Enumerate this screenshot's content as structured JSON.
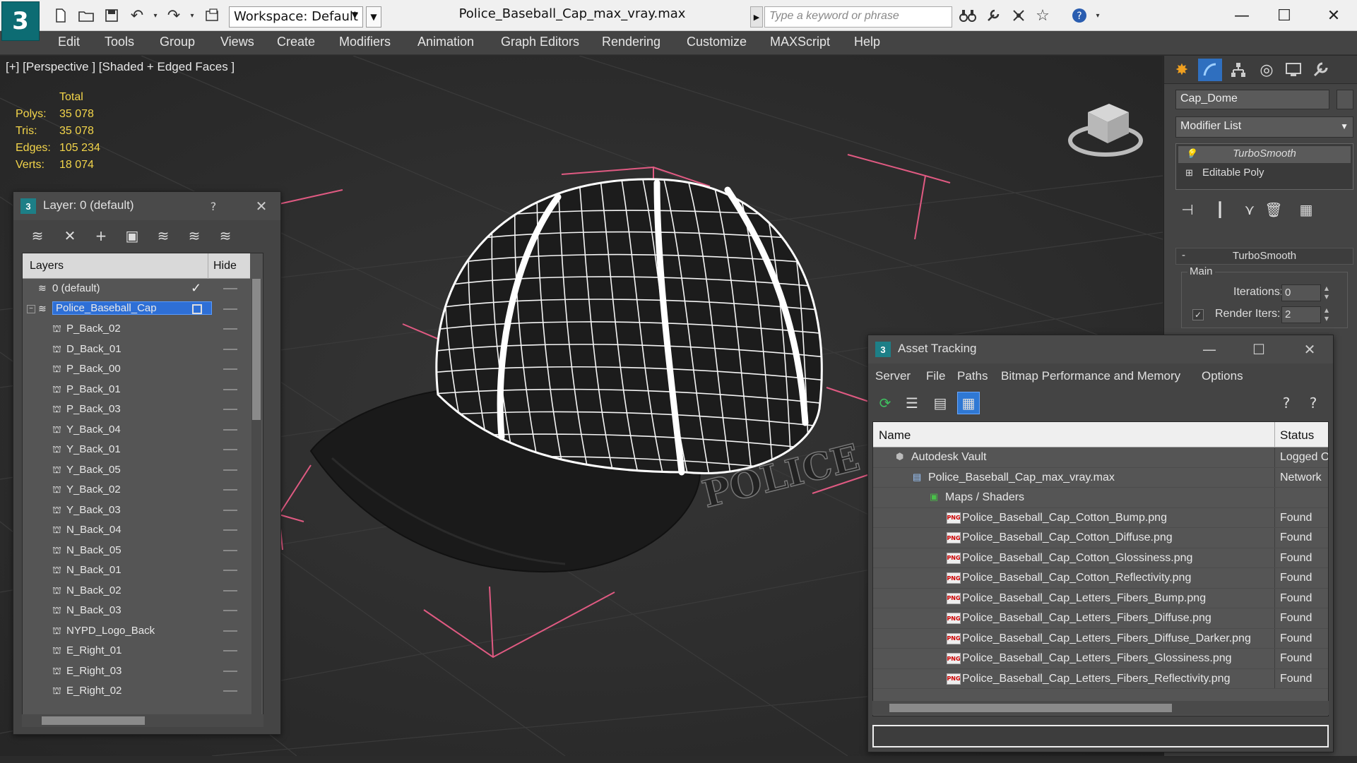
{
  "app": {
    "workspace_label": "Workspace: Default",
    "document_title": "Police_Baseball_Cap_max_vray.max",
    "search_placeholder": "Type a keyword or phrase"
  },
  "menu": [
    "Edit",
    "Tools",
    "Group",
    "Views",
    "Create",
    "Modifiers",
    "Animation",
    "Graph Editors",
    "Rendering",
    "Customize",
    "MAXScript",
    "Help"
  ],
  "viewport": {
    "label": "[+] [Perspective ] [Shaded + Edged Faces ]",
    "stats": {
      "header": "Total",
      "rows": [
        {
          "k": "Polys:",
          "v": "35 078"
        },
        {
          "k": "Tris:",
          "v": "35 078"
        },
        {
          "k": "Edges:",
          "v": "105 234"
        },
        {
          "k": "Verts:",
          "v": "18 074"
        }
      ]
    },
    "cap_text": "POLICE"
  },
  "command_panel": {
    "object_name": "Cap_Dome",
    "modifier_list": "Modifier List",
    "stack": [
      "TurboSmooth",
      "Editable Poly"
    ],
    "rollout_title": "TurboSmooth",
    "group_label": "Main",
    "iterations_label": "Iterations:",
    "iterations_value": "0",
    "render_iters_label": "Render Iters:",
    "render_iters_value": "2"
  },
  "layer_window": {
    "title": "Layer: 0 (default)",
    "help": "?",
    "col_layers": "Layers",
    "col_hide": "Hide",
    "layers": [
      {
        "name": "0 (default)",
        "level": 0,
        "type": "layer",
        "current": true
      },
      {
        "name": "Police_Baseball_Cap",
        "level": 0,
        "type": "layer",
        "selected": true
      },
      {
        "name": "P_Back_02",
        "level": 1,
        "type": "object"
      },
      {
        "name": "D_Back_01",
        "level": 1,
        "type": "object"
      },
      {
        "name": "P_Back_00",
        "level": 1,
        "type": "object"
      },
      {
        "name": "P_Back_01",
        "level": 1,
        "type": "object"
      },
      {
        "name": "P_Back_03",
        "level": 1,
        "type": "object"
      },
      {
        "name": "Y_Back_04",
        "level": 1,
        "type": "object"
      },
      {
        "name": "Y_Back_01",
        "level": 1,
        "type": "object"
      },
      {
        "name": "Y_Back_05",
        "level": 1,
        "type": "object"
      },
      {
        "name": "Y_Back_02",
        "level": 1,
        "type": "object"
      },
      {
        "name": "Y_Back_03",
        "level": 1,
        "type": "object"
      },
      {
        "name": "N_Back_04",
        "level": 1,
        "type": "object"
      },
      {
        "name": "N_Back_05",
        "level": 1,
        "type": "object"
      },
      {
        "name": "N_Back_01",
        "level": 1,
        "type": "object"
      },
      {
        "name": "N_Back_02",
        "level": 1,
        "type": "object"
      },
      {
        "name": "N_Back_03",
        "level": 1,
        "type": "object"
      },
      {
        "name": "NYPD_Logo_Back",
        "level": 1,
        "type": "object"
      },
      {
        "name": "E_Right_01",
        "level": 1,
        "type": "object"
      },
      {
        "name": "E_Right_03",
        "level": 1,
        "type": "object"
      },
      {
        "name": "E_Right_02",
        "level": 1,
        "type": "object"
      }
    ]
  },
  "asset_window": {
    "title": "Asset Tracking",
    "menu": [
      "Server",
      "File",
      "Paths",
      "Bitmap Performance and Memory",
      "Options"
    ],
    "col_name": "Name",
    "col_status": "Status",
    "rows": [
      {
        "name": "Autodesk Vault",
        "status": "Logged Out",
        "level": 0,
        "icon": "vault"
      },
      {
        "name": "Police_Baseball_Cap_max_vray.max",
        "status": "Network",
        "level": 1,
        "icon": "max"
      },
      {
        "name": "Maps / Shaders",
        "status": "",
        "level": 2,
        "icon": "maps"
      },
      {
        "name": "Police_Baseball_Cap_Cotton_Bump.png",
        "status": "Found",
        "level": 3,
        "icon": "png"
      },
      {
        "name": "Police_Baseball_Cap_Cotton_Diffuse.png",
        "status": "Found",
        "level": 3,
        "icon": "png"
      },
      {
        "name": "Police_Baseball_Cap_Cotton_Glossiness.png",
        "status": "Found",
        "level": 3,
        "icon": "png"
      },
      {
        "name": "Police_Baseball_Cap_Cotton_Reflectivity.png",
        "status": "Found",
        "level": 3,
        "icon": "png"
      },
      {
        "name": "Police_Baseball_Cap_Letters_Fibers_Bump.png",
        "status": "Found",
        "level": 3,
        "icon": "png"
      },
      {
        "name": "Police_Baseball_Cap_Letters_Fibers_Diffuse.png",
        "status": "Found",
        "level": 3,
        "icon": "png"
      },
      {
        "name": "Police_Baseball_Cap_Letters_Fibers_Diffuse_Darker.png",
        "status": "Found",
        "level": 3,
        "icon": "png"
      },
      {
        "name": "Police_Baseball_Cap_Letters_Fibers_Glossiness.png",
        "status": "Found",
        "level": 3,
        "icon": "png"
      },
      {
        "name": "Police_Baseball_Cap_Letters_Fibers_Reflectivity.png",
        "status": "Found",
        "level": 3,
        "icon": "png"
      }
    ]
  },
  "colors": {
    "stats_yellow": "#f3d54a",
    "selection_blue": "#2e6fd6",
    "app_teal": "#0d6c73",
    "gizmo_pink": "#e05a82"
  }
}
